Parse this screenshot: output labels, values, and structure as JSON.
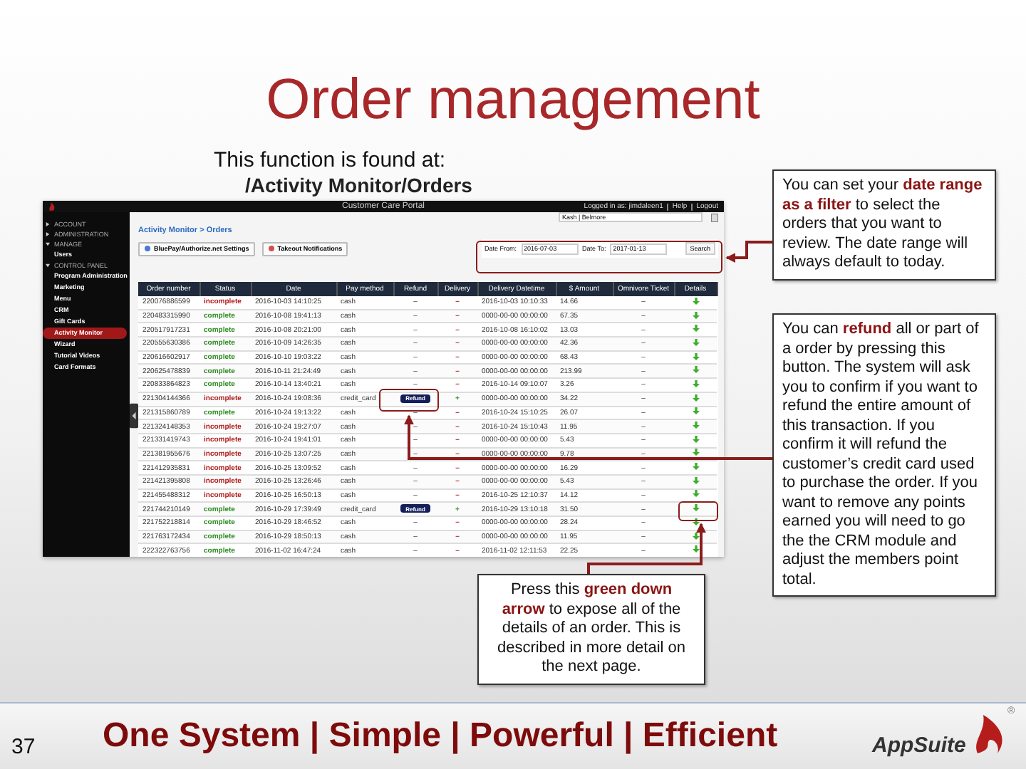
{
  "slide_title": "Order management",
  "intro": {
    "line": "This function is found at:",
    "path": "/Activity Monitor/Orders"
  },
  "portal": {
    "title": "Customer Care Portal",
    "user_links": [
      "Logged in as: jimdaleen1",
      "Help",
      "Logout"
    ],
    "sidebar": [
      {
        "label": "ACCOUNT",
        "kind": "section",
        "expanded": false
      },
      {
        "label": "ADMINISTRATION",
        "kind": "section",
        "expanded": false
      },
      {
        "label": "MANAGE",
        "kind": "section",
        "expanded": true,
        "children": [
          {
            "label": "Users",
            "selected": false
          }
        ]
      },
      {
        "label": "CONTROL PANEL",
        "kind": "section",
        "expanded": true,
        "children": [
          {
            "label": "Program Administration",
            "selected": false
          },
          {
            "label": "Marketing",
            "selected": false
          },
          {
            "label": "Menu",
            "selected": false
          },
          {
            "label": "CRM",
            "selected": false
          },
          {
            "label": "Gift Cards",
            "selected": false
          },
          {
            "label": "Activity Monitor",
            "selected": true
          },
          {
            "label": "Wizard",
            "selected": false
          },
          {
            "label": "Tutorial Videos",
            "selected": false
          },
          {
            "label": "Card Formats",
            "selected": false
          }
        ]
      }
    ],
    "location_select": "Kash | Belmore",
    "breadcrumb": "Activity Monitor > Orders",
    "toolbar_buttons": [
      "BluePay/Authorize.net Settings",
      "Takeout Notifications"
    ],
    "date_filter": {
      "from_label": "Date From:",
      "from": "2016-07-03",
      "to_label": "Date To:",
      "to": "2017-01-13",
      "button": "Search"
    },
    "table": {
      "columns": [
        "Order number",
        "Status",
        "Date",
        "Pay method",
        "Refund",
        "Delivery",
        "Delivery Datetime",
        "$ Amount",
        "Omnivore Ticket",
        "Details"
      ],
      "rows": [
        {
          "order": "220076886599",
          "status": "incomplete",
          "complete": false,
          "date": "2016-10-03 14:10:25",
          "pay": "cash",
          "refund": {
            "kind": "text",
            "label": "–"
          },
          "delivery": "–",
          "delivery_ok": false,
          "delivery_datetime": "2016-10-03 10:10:33",
          "amount": "14.66",
          "omnivore": "–"
        },
        {
          "order": "220483315990",
          "status": "complete",
          "complete": true,
          "date": "2016-10-08 19:41:13",
          "pay": "cash",
          "refund": {
            "kind": "text",
            "label": "–"
          },
          "delivery": "–",
          "delivery_ok": false,
          "delivery_datetime": "0000-00-00 00:00:00",
          "amount": "67.35",
          "omnivore": "–"
        },
        {
          "order": "220517917231",
          "status": "complete",
          "complete": true,
          "date": "2016-10-08 20:21:00",
          "pay": "cash",
          "refund": {
            "kind": "text",
            "label": "–"
          },
          "delivery": "–",
          "delivery_ok": false,
          "delivery_datetime": "2016-10-08 16:10:02",
          "amount": "13.03",
          "omnivore": "–"
        },
        {
          "order": "220555630386",
          "status": "complete",
          "complete": true,
          "date": "2016-10-09 14:26:35",
          "pay": "cash",
          "refund": {
            "kind": "text",
            "label": "–"
          },
          "delivery": "–",
          "delivery_ok": false,
          "delivery_datetime": "0000-00-00 00:00:00",
          "amount": "42.36",
          "omnivore": "–"
        },
        {
          "order": "220616602917",
          "status": "complete",
          "complete": true,
          "date": "2016-10-10 19:03:22",
          "pay": "cash",
          "refund": {
            "kind": "text",
            "label": "–"
          },
          "delivery": "–",
          "delivery_ok": false,
          "delivery_datetime": "0000-00-00 00:00:00",
          "amount": "68.43",
          "omnivore": "–"
        },
        {
          "order": "220625478839",
          "status": "complete",
          "complete": true,
          "date": "2016-10-11 21:24:49",
          "pay": "cash",
          "refund": {
            "kind": "text",
            "label": "–"
          },
          "delivery": "–",
          "delivery_ok": false,
          "delivery_datetime": "0000-00-00 00:00:00",
          "amount": "213.99",
          "omnivore": "–"
        },
        {
          "order": "220833864823",
          "status": "complete",
          "complete": true,
          "date": "2016-10-14 13:40:21",
          "pay": "cash",
          "refund": {
            "kind": "text",
            "label": "–"
          },
          "delivery": "–",
          "delivery_ok": false,
          "delivery_datetime": "2016-10-14 09:10:07",
          "amount": "3.26",
          "omnivore": "–"
        },
        {
          "order": "221304144366",
          "status": "incomplete",
          "complete": false,
          "date": "2016-10-24 19:08:36",
          "pay": "credit_card",
          "refund": {
            "kind": "button",
            "label": "Refund"
          },
          "delivery": "+",
          "delivery_ok": true,
          "delivery_datetime": "0000-00-00 00:00:00",
          "amount": "34.22",
          "omnivore": "–"
        },
        {
          "order": "221315860789",
          "status": "complete",
          "complete": true,
          "date": "2016-10-24 19:13:22",
          "pay": "cash",
          "refund": {
            "kind": "text",
            "label": "–"
          },
          "delivery": "–",
          "delivery_ok": false,
          "delivery_datetime": "2016-10-24 15:10:25",
          "amount": "26.07",
          "omnivore": "–"
        },
        {
          "order": "221324148353",
          "status": "incomplete",
          "complete": false,
          "date": "2016-10-24 19:27:07",
          "pay": "cash",
          "refund": {
            "kind": "text",
            "label": "–"
          },
          "delivery": "–",
          "delivery_ok": false,
          "delivery_datetime": "2016-10-24 15:10:43",
          "amount": "11.95",
          "omnivore": "–"
        },
        {
          "order": "221331419743",
          "status": "incomplete",
          "complete": false,
          "date": "2016-10-24 19:41:01",
          "pay": "cash",
          "refund": {
            "kind": "text",
            "label": "–"
          },
          "delivery": "–",
          "delivery_ok": false,
          "delivery_datetime": "0000-00-00 00:00:00",
          "amount": "5.43",
          "omnivore": "–"
        },
        {
          "order": "221381955676",
          "status": "incomplete",
          "complete": false,
          "date": "2016-10-25 13:07:25",
          "pay": "cash",
          "refund": {
            "kind": "text",
            "label": "–"
          },
          "delivery": "–",
          "delivery_ok": false,
          "delivery_datetime": "0000-00-00 00:00:00",
          "amount": "9.78",
          "omnivore": "–"
        },
        {
          "order": "221412935831",
          "status": "incomplete",
          "complete": false,
          "date": "2016-10-25 13:09:52",
          "pay": "cash",
          "refund": {
            "kind": "text",
            "label": "–"
          },
          "delivery": "–",
          "delivery_ok": false,
          "delivery_datetime": "0000-00-00 00:00:00",
          "amount": "16.29",
          "omnivore": "–"
        },
        {
          "order": "221421395808",
          "status": "incomplete",
          "complete": false,
          "date": "2016-10-25 13:26:46",
          "pay": "cash",
          "refund": {
            "kind": "text",
            "label": "–"
          },
          "delivery": "–",
          "delivery_ok": false,
          "delivery_datetime": "0000-00-00 00:00:00",
          "amount": "5.43",
          "omnivore": "–"
        },
        {
          "order": "221455488312",
          "status": "incomplete",
          "complete": false,
          "date": "2016-10-25 16:50:13",
          "pay": "cash",
          "refund": {
            "kind": "text",
            "label": "–"
          },
          "delivery": "–",
          "delivery_ok": false,
          "delivery_datetime": "2016-10-25 12:10:37",
          "amount": "14.12",
          "omnivore": "–"
        },
        {
          "order": "221744210149",
          "status": "complete",
          "complete": true,
          "date": "2016-10-29 17:39:49",
          "pay": "credit_card",
          "refund": {
            "kind": "button",
            "label": "Refund"
          },
          "delivery": "+",
          "delivery_ok": true,
          "delivery_datetime": "2016-10-29 13:10:18",
          "amount": "31.50",
          "omnivore": "–"
        },
        {
          "order": "221752218814",
          "status": "complete",
          "complete": true,
          "date": "2016-10-29 18:46:52",
          "pay": "cash",
          "refund": {
            "kind": "text",
            "label": "–"
          },
          "delivery": "–",
          "delivery_ok": false,
          "delivery_datetime": "0000-00-00 00:00:00",
          "amount": "28.24",
          "omnivore": "–"
        },
        {
          "order": "221763172434",
          "status": "complete",
          "complete": true,
          "date": "2016-10-29 18:50:13",
          "pay": "cash",
          "refund": {
            "kind": "text",
            "label": "–"
          },
          "delivery": "–",
          "delivery_ok": false,
          "delivery_datetime": "0000-00-00 00:00:00",
          "amount": "11.95",
          "omnivore": "–"
        },
        {
          "order": "222322763756",
          "status": "complete",
          "complete": true,
          "date": "2016-11-02 16:47:24",
          "pay": "cash",
          "refund": {
            "kind": "text",
            "label": "–"
          },
          "delivery": "–",
          "delivery_ok": false,
          "delivery_datetime": "2016-11-02 12:11:53",
          "amount": "22.25",
          "omnivore": "–"
        }
      ]
    }
  },
  "callouts": [
    "You can set your **date range as a filter** to select the orders that you want to review.  The date range will always default to today.",
    "You can **refund** all or part of a order by pressing this button.  The system will ask you to confirm if you want to refund the entire amount of this transaction.  If you confirm it will refund the customer’s credit card used to purchase the order.  If you want to remove any points earned you will need to go the the CRM module and adjust the members point total.",
    "Press this **green down arrow** to expose all of the details of an order.  This is described in more detail on the next page."
  ],
  "footer": {
    "page": "37",
    "slogan": "One System | Simple | Powerful | Efficient",
    "logo": "AppSuite",
    "logo_mark": "®"
  }
}
